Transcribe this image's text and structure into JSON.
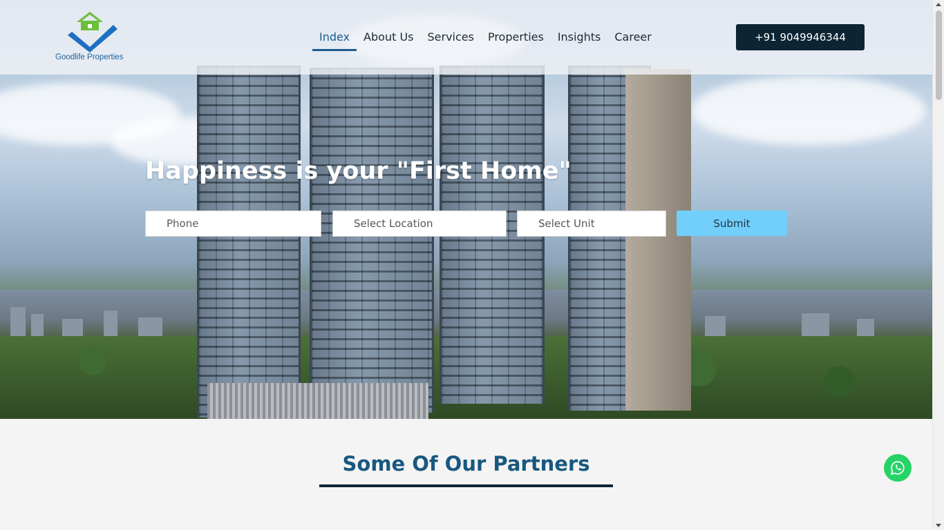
{
  "brand": {
    "name": "Goodlife Properties",
    "logo_colors": {
      "roof": "#6cbf3b",
      "check": "#1d6fc4"
    }
  },
  "nav": {
    "items": [
      {
        "label": "Index",
        "active": true
      },
      {
        "label": "About Us",
        "active": false
      },
      {
        "label": "Services",
        "active": false
      },
      {
        "label": "Properties",
        "active": false
      },
      {
        "label": "Insights",
        "active": false
      },
      {
        "label": "Career",
        "active": false
      }
    ],
    "phone_label": "+91 9049946344"
  },
  "hero": {
    "headline": "Happiness is your \"First Home\"",
    "form": {
      "phone_placeholder": "Phone",
      "location_placeholder": "Select Location",
      "unit_placeholder": "Select Unit",
      "submit_label": "Submit"
    }
  },
  "partners": {
    "title": "Some Of Our Partners"
  },
  "colors": {
    "accent": "#1a5c8f",
    "dark": "#0d2434",
    "submit": "#72cffb",
    "whatsapp": "#25d366"
  },
  "floating": {
    "whatsapp_icon": "whatsapp-icon"
  }
}
